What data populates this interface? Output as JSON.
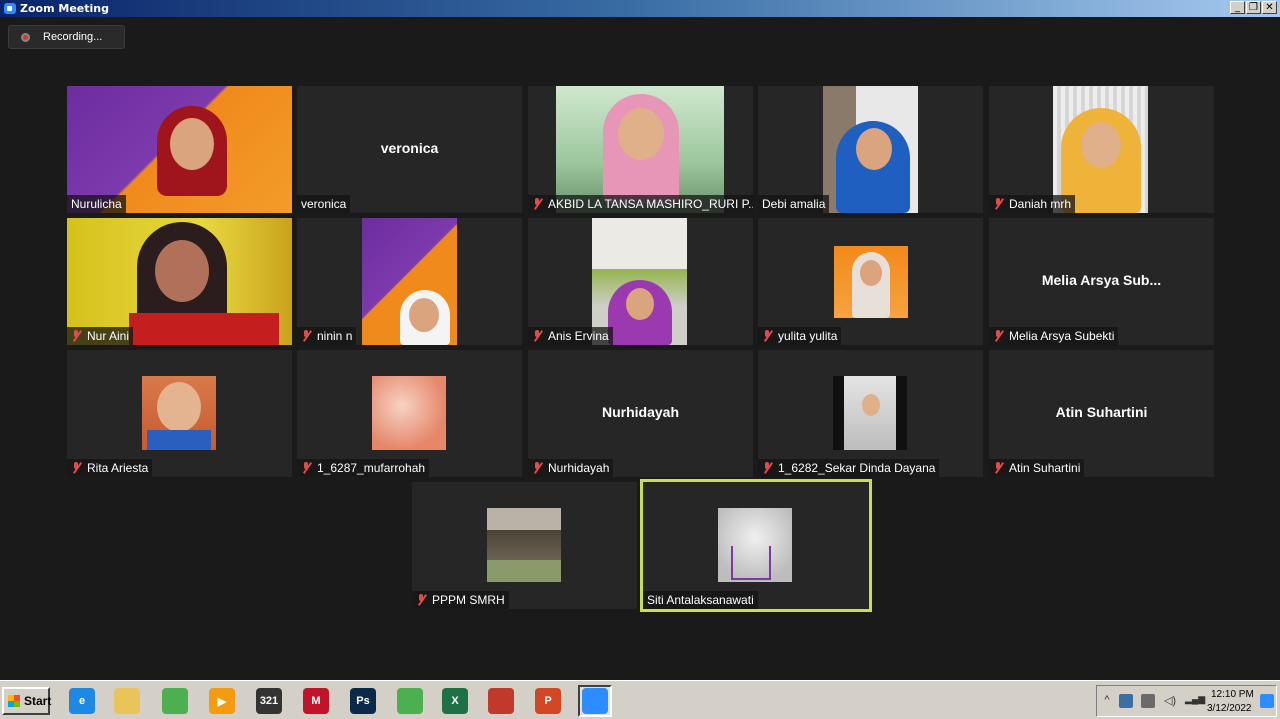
{
  "window": {
    "title": "Zoom Meeting",
    "minimize": "_",
    "restore": "❐",
    "close": "✕"
  },
  "recording": {
    "label": "Recording..."
  },
  "tiles": [
    {
      "name": "Nurulicha",
      "muted": false
    },
    {
      "name": "veronica",
      "display": "veronica",
      "muted": false
    },
    {
      "name": "AKBID LA TANSA MASHIRO_RURI P...",
      "muted": true
    },
    {
      "name": "Debi amalia",
      "muted": false
    },
    {
      "name": "Daniah mrh",
      "muted": true
    },
    {
      "name": "Nur Aini",
      "muted": true
    },
    {
      "name": "ninin n",
      "muted": true
    },
    {
      "name": "Anis Ervina",
      "muted": true
    },
    {
      "name": "yulita yulita",
      "muted": true
    },
    {
      "name": "Melia Arsya Subekti",
      "display": "Melia Arsya Sub...",
      "muted": true
    },
    {
      "name": "Rita Ariesta",
      "muted": true
    },
    {
      "name": "1_6287_mufarrohah",
      "muted": true
    },
    {
      "name": "Nurhidayah",
      "display": "Nurhidayah",
      "muted": true
    },
    {
      "name": "1_6282_Sekar Dinda Dayana",
      "muted": true
    },
    {
      "name": "Atin Suhartini",
      "display": "Atin Suhartini",
      "muted": true
    },
    {
      "name": "PPPM SMRH",
      "muted": true
    },
    {
      "name": "Siti Antalaksanawati",
      "muted": false,
      "active": true
    }
  ],
  "taskbar": {
    "start_label": "Start",
    "apps": [
      {
        "icon": "internet-explorer-icon",
        "glyph": "e",
        "color": "#1e88e5"
      },
      {
        "icon": "file-explorer-icon",
        "glyph": "",
        "color": "#e8c45a"
      },
      {
        "icon": "chrome-icon",
        "glyph": "",
        "color": "#4caf50"
      },
      {
        "icon": "media-player-icon",
        "glyph": "▶",
        "color": "#f39c12"
      },
      {
        "icon": "media-player-classic-icon",
        "glyph": "321",
        "color": "#333333"
      },
      {
        "icon": "mendeley-icon",
        "glyph": "M",
        "color": "#c0142b"
      },
      {
        "icon": "photoshop-icon",
        "glyph": "Ps",
        "color": "#0b2a4a"
      },
      {
        "icon": "chrome-user-icon",
        "glyph": "",
        "color": "#4caf50"
      },
      {
        "icon": "excel-icon",
        "glyph": "X",
        "color": "#1e7145"
      },
      {
        "icon": "presentation-tool-icon",
        "glyph": "",
        "color": "#c0392b"
      },
      {
        "icon": "powerpoint-icon",
        "glyph": "P",
        "color": "#d24726"
      },
      {
        "icon": "zoom-icon",
        "glyph": "",
        "color": "#2d8cff"
      }
    ],
    "clock_time": "12:10 PM",
    "clock_date": "3/12/2022"
  }
}
